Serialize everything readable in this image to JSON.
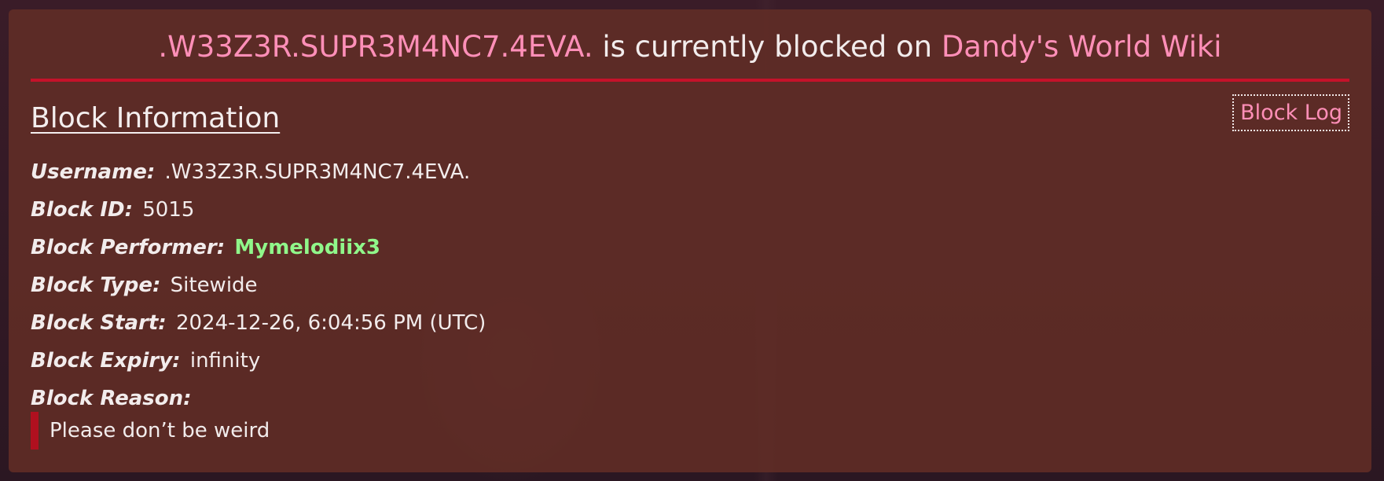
{
  "header": {
    "username": ".W33Z3R.SUPR3M4NC7.4EVA.",
    "middle_text": " is currently blocked on ",
    "wiki_name": "Dandy's World Wiki"
  },
  "section": {
    "title": "Block Information",
    "block_log_label": "Block Log"
  },
  "fields": {
    "username_label": "Username:",
    "username_value": ".W33Z3R.SUPR3M4NC7.4EVA.",
    "block_id_label": "Block ID:",
    "block_id_value": "5015",
    "performer_label": "Block Performer:",
    "performer_value": "Mymelodiix3",
    "type_label": "Block Type:",
    "type_value": "Sitewide",
    "start_label": "Block Start:",
    "start_value": "2024-12-26, 6:04:56 PM (UTC)",
    "expiry_label": "Block Expiry:",
    "expiry_value": "infinity",
    "reason_label": "Block Reason:",
    "reason_value": "Please don’t be weird"
  },
  "colors": {
    "accent_pink": "#ff8fb8",
    "divider_red": "#c4122a",
    "performer_green": "#90f78a",
    "panel_brown": "#5f2d26"
  }
}
